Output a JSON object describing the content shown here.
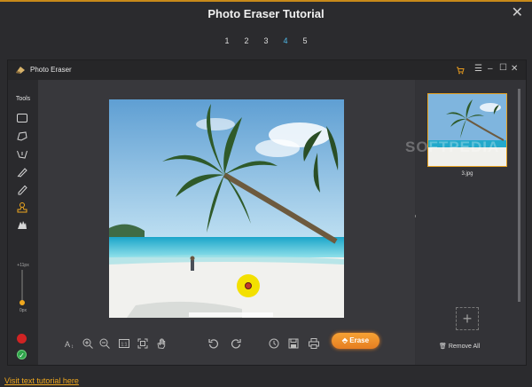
{
  "tutorial": {
    "title": "Photo Eraser Tutorial",
    "pages": [
      "1",
      "2",
      "3",
      "4",
      "5"
    ],
    "active_page": "4",
    "text_link": "Visit text tutorial here"
  },
  "app": {
    "title": "Photo Eraser",
    "tools_label": "Tools",
    "brush_size_max": "+11px",
    "brush_size_min": "0px",
    "erase_label": "Erase",
    "thumbnail_name": "3.jpg",
    "remove_all_label": "Remove All"
  },
  "watermark": "SOFTPEDIA",
  "colors": {
    "accent": "#f0a81e",
    "active_page": "#4fb8e8",
    "brush": "#f3e000",
    "red_swatch": "#d02323",
    "green_check": "#2ea34a"
  }
}
